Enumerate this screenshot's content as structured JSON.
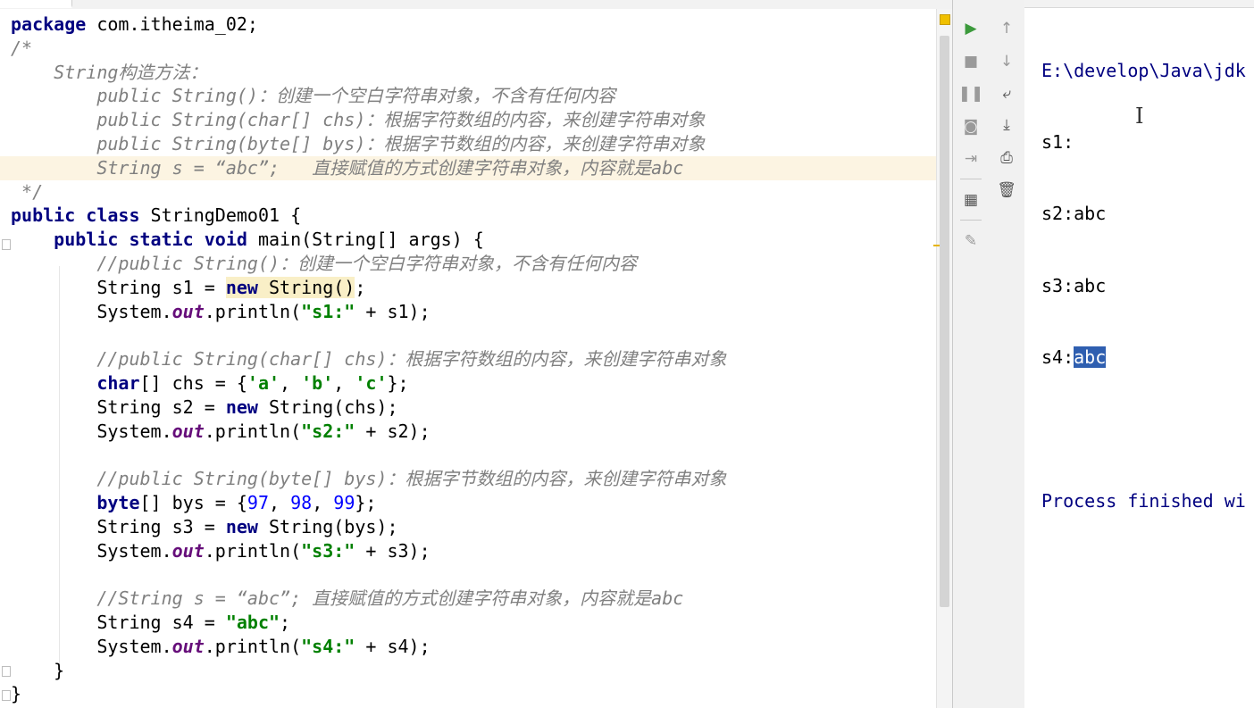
{
  "editor": {
    "lines": [
      {
        "html_parts": [
          {
            "t": "kw",
            "v": "package"
          },
          {
            "t": "plain",
            "v": " com.itheima_02;"
          }
        ]
      },
      {
        "html_parts": [
          {
            "t": "cm",
            "v": "/*"
          }
        ]
      },
      {
        "html_parts": [
          {
            "t": "cm",
            "v": "    String构造方法："
          }
        ]
      },
      {
        "html_parts": [
          {
            "t": "cm",
            "v": "        public String()：创建一个空白字符串对象，不含有任何内容"
          }
        ]
      },
      {
        "html_parts": [
          {
            "t": "cm",
            "v": "        public String(char[] chs)：根据字符数组的内容，来创建字符串对象"
          }
        ]
      },
      {
        "html_parts": [
          {
            "t": "cm",
            "v": "        public String(byte[] bys)：根据字节数组的内容，来创建字符串对象"
          }
        ]
      },
      {
        "highlight": true,
        "html_parts": [
          {
            "t": "cm",
            "v": "        String s = “abc”;   直接赋值的方式创建字符串对象，内容就是abc"
          }
        ]
      },
      {
        "html_parts": [
          {
            "t": "cm",
            "v": " */"
          }
        ]
      },
      {
        "html_parts": [
          {
            "t": "kw",
            "v": "public class"
          },
          {
            "t": "plain",
            "v": " StringDemo01 {"
          }
        ]
      },
      {
        "html_parts": [
          {
            "t": "plain",
            "v": "    "
          },
          {
            "t": "kw",
            "v": "public static void"
          },
          {
            "t": "plain",
            "v": " main(String[] args) {"
          }
        ]
      },
      {
        "html_parts": [
          {
            "t": "cm",
            "v": "        //public String()：创建一个空白字符串对象，不含有任何内容"
          }
        ]
      },
      {
        "html_parts": [
          {
            "t": "plain",
            "v": "        String s1 = "
          },
          {
            "t": "kwmark",
            "v": "new"
          },
          {
            "t": "mark",
            "v": " String()"
          },
          {
            "t": "plain",
            "v": ";"
          }
        ]
      },
      {
        "html_parts": [
          {
            "t": "plain",
            "v": "        System."
          },
          {
            "t": "fld",
            "v": "out"
          },
          {
            "t": "plain",
            "v": ".println("
          },
          {
            "t": "str",
            "v": "\"s1:\""
          },
          {
            "t": "plain",
            "v": " + s1);"
          }
        ]
      },
      {
        "html_parts": []
      },
      {
        "html_parts": [
          {
            "t": "cm",
            "v": "        //public String(char[] chs)：根据字符数组的内容，来创建字符串对象"
          }
        ]
      },
      {
        "html_parts": [
          {
            "t": "plain",
            "v": "        "
          },
          {
            "t": "kw",
            "v": "char"
          },
          {
            "t": "plain",
            "v": "[] chs = {"
          },
          {
            "t": "str",
            "v": "'a'"
          },
          {
            "t": "plain",
            "v": ", "
          },
          {
            "t": "str",
            "v": "'b'"
          },
          {
            "t": "plain",
            "v": ", "
          },
          {
            "t": "str",
            "v": "'c'"
          },
          {
            "t": "plain",
            "v": "};"
          }
        ]
      },
      {
        "html_parts": [
          {
            "t": "plain",
            "v": "        String s2 = "
          },
          {
            "t": "kw",
            "v": "new"
          },
          {
            "t": "plain",
            "v": " String(chs);"
          }
        ]
      },
      {
        "html_parts": [
          {
            "t": "plain",
            "v": "        System."
          },
          {
            "t": "fld",
            "v": "out"
          },
          {
            "t": "plain",
            "v": ".println("
          },
          {
            "t": "str",
            "v": "\"s2:\""
          },
          {
            "t": "plain",
            "v": " + s2);"
          }
        ]
      },
      {
        "html_parts": []
      },
      {
        "html_parts": [
          {
            "t": "cm",
            "v": "        //public String(byte[] bys)：根据字节数组的内容，来创建字符串对象"
          }
        ]
      },
      {
        "html_parts": [
          {
            "t": "plain",
            "v": "        "
          },
          {
            "t": "kw",
            "v": "byte"
          },
          {
            "t": "plain",
            "v": "[] bys = {"
          },
          {
            "t": "num",
            "v": "97"
          },
          {
            "t": "plain",
            "v": ", "
          },
          {
            "t": "num",
            "v": "98"
          },
          {
            "t": "plain",
            "v": ", "
          },
          {
            "t": "num",
            "v": "99"
          },
          {
            "t": "plain",
            "v": "};"
          }
        ]
      },
      {
        "html_parts": [
          {
            "t": "plain",
            "v": "        String s3 = "
          },
          {
            "t": "kw",
            "v": "new"
          },
          {
            "t": "plain",
            "v": " String(bys);"
          }
        ]
      },
      {
        "html_parts": [
          {
            "t": "plain",
            "v": "        System."
          },
          {
            "t": "fld",
            "v": "out"
          },
          {
            "t": "plain",
            "v": ".println("
          },
          {
            "t": "str",
            "v": "\"s3:\""
          },
          {
            "t": "plain",
            "v": " + s3);"
          }
        ]
      },
      {
        "html_parts": []
      },
      {
        "html_parts": [
          {
            "t": "cm",
            "v": "        //String s = “abc”; 直接赋值的方式创建字符串对象，内容就是abc"
          }
        ]
      },
      {
        "html_parts": [
          {
            "t": "plain",
            "v": "        String s4 = "
          },
          {
            "t": "str",
            "v": "\"abc\""
          },
          {
            "t": "plain",
            "v": ";"
          }
        ]
      },
      {
        "html_parts": [
          {
            "t": "plain",
            "v": "        System."
          },
          {
            "t": "fld",
            "v": "out"
          },
          {
            "t": "plain",
            "v": ".println("
          },
          {
            "t": "str",
            "v": "\"s4:\""
          },
          {
            "t": "plain",
            "v": " + s4);"
          }
        ]
      },
      {
        "html_parts": [
          {
            "t": "plain",
            "v": "    }"
          }
        ]
      },
      {
        "html_parts": [
          {
            "t": "plain",
            "v": "}"
          }
        ]
      }
    ]
  },
  "run_toolbar": {
    "left": [
      {
        "name": "rerun-icon",
        "glyph": "▶",
        "style": "green"
      },
      {
        "name": "stop-icon",
        "glyph": "■",
        "style": ""
      },
      {
        "name": "pause-icon",
        "glyph": "❚❚",
        "style": ""
      },
      {
        "name": "camera-icon",
        "glyph": "◙",
        "style": ""
      },
      {
        "name": "exit-icon",
        "glyph": "⇥",
        "style": ""
      },
      {
        "name": "layout-icon",
        "glyph": "▦",
        "style": "dark"
      },
      {
        "name": "pin-icon",
        "glyph": "✎",
        "style": ""
      }
    ],
    "right": [
      {
        "name": "up-arrow-icon",
        "glyph": "↑",
        "style": ""
      },
      {
        "name": "down-arrow-icon",
        "glyph": "↓",
        "style": ""
      },
      {
        "name": "soft-wrap-icon",
        "glyph": "⤶",
        "style": "dark"
      },
      {
        "name": "scroll-to-end-icon",
        "glyph": "⤓",
        "style": "dark"
      },
      {
        "name": "print-icon",
        "glyph": "⎙",
        "style": "dark"
      },
      {
        "name": "trash-icon",
        "glyph": "🗑",
        "style": "dark"
      }
    ]
  },
  "console": {
    "path": "E:\\develop\\Java\\jdk",
    "s1": "s1:",
    "s2": "s2:abc",
    "s3": "s3:abc",
    "s4_label": "s4:",
    "s4_selected": "abc",
    "finished": "Process finished wi"
  }
}
